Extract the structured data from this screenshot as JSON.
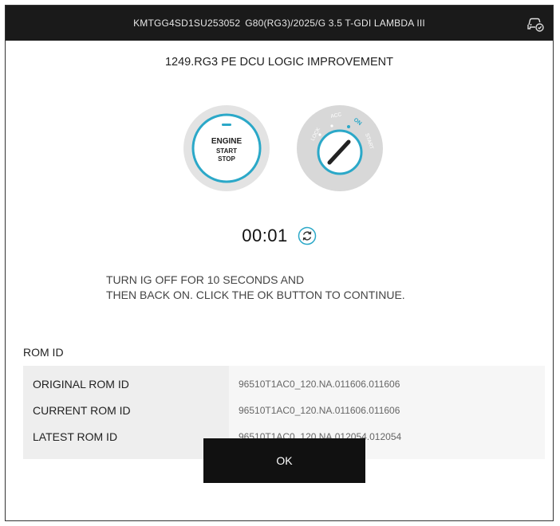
{
  "header": {
    "vin": "KMTGG4SD1SU253052",
    "vehicle": "G80(RG3)/2025/G 3.5 T-GDI LAMBDA III",
    "icon": "vehicle-check-icon"
  },
  "title": "1249.RG3 PE DCU LOGIC IMPROVEMENT",
  "engine_button": {
    "line1": "ENGINE",
    "line2": "START",
    "line3": "STOP"
  },
  "ignition_key": {
    "positions": [
      "LOCK",
      "ACC",
      "ON",
      "START"
    ],
    "active": "ON"
  },
  "timer": {
    "value": "00:01",
    "icon": "refresh-icon"
  },
  "instruction": {
    "line1": "TURN IG OFF FOR 10 SECONDS AND",
    "line2": "THEN BACK ON. CLICK THE OK BUTTON TO CONTINUE."
  },
  "rom": {
    "section_label": "ROM ID",
    "rows": [
      {
        "label": "ORIGINAL ROM ID",
        "value": "96510T1AC0_120.NA.011606.011606"
      },
      {
        "label": "CURRENT ROM ID",
        "value": "96510T1AC0_120.NA.011606.011606"
      },
      {
        "label": "LATEST ROM ID",
        "value": "96510T1AC0_120.NA.012054.012054"
      }
    ]
  },
  "ok_button": {
    "label": "OK"
  },
  "colors": {
    "accent": "#2ba8c8",
    "header_bg": "#1a1a1a",
    "button_bg": "#111111",
    "table_bg": "#eeeeee"
  }
}
